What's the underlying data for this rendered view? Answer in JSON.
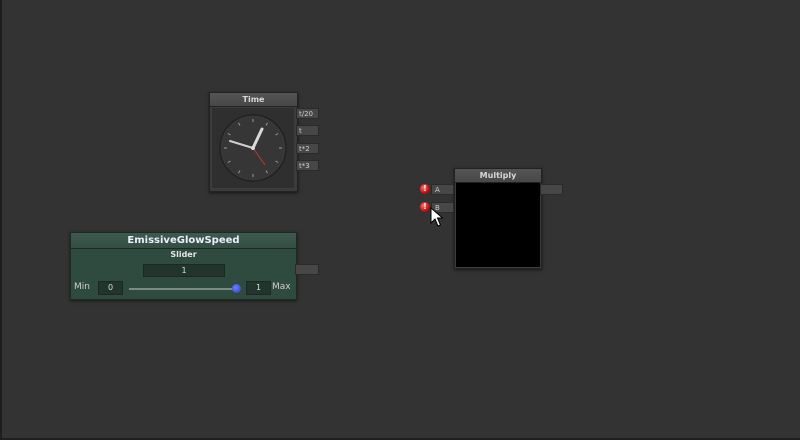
{
  "time_node": {
    "title": "Time",
    "outputs": [
      "t/20",
      "t",
      "t*2",
      "t*3"
    ]
  },
  "multiply_node": {
    "title": "Multiply",
    "inputs": [
      "A",
      "B"
    ],
    "input_error_icon": "!"
  },
  "slider_node": {
    "title": "EmissiveGlowSpeed",
    "subtitle": "Slider",
    "value": "1",
    "min_label": "Min",
    "min_value": "0",
    "max_label": "Max",
    "max_value": "1",
    "slider_fraction": 1.0
  },
  "colors": {
    "canvas_bg": "#333333",
    "slider_node_bg": "#2f4a3f",
    "error": "#c00000",
    "clock_hand_second": "#c0392b",
    "slider_thumb": "#3b4fd8"
  },
  "icons": {
    "clock": "clock-icon",
    "error": "error-icon",
    "cursor": "mouse-pointer-icon"
  }
}
